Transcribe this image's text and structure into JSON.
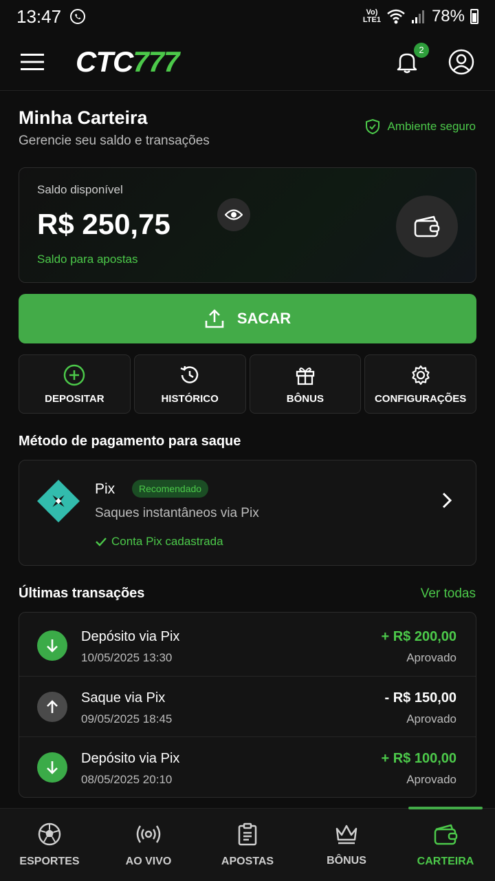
{
  "status_bar": {
    "time": "13:47",
    "network_line1": "Vo)",
    "network_line2": "LTE1",
    "battery": "78%"
  },
  "header": {
    "logo_white": "CTC",
    "logo_green": "777",
    "notification_count": "2"
  },
  "page": {
    "title": "Minha Carteira",
    "subtitle": "Gerencie seu saldo e transações",
    "secure_label": "Ambiente seguro"
  },
  "balance": {
    "label": "Saldo disponível",
    "value": "R$ 250,75",
    "note": "Saldo para apostas"
  },
  "withdraw_button": {
    "label": "SACAR"
  },
  "actions": [
    {
      "label": "DEPOSITAR",
      "icon": "plus-circle-icon"
    },
    {
      "label": "HISTÓRICO",
      "icon": "history-icon"
    },
    {
      "label": "BÔNUS",
      "icon": "gift-icon"
    },
    {
      "label": "CONFIGURAÇÕES",
      "icon": "gear-icon"
    }
  ],
  "payment": {
    "section_title": "Método de pagamento para saque",
    "method_name": "Pix",
    "badge": "Recomendado",
    "description": "Saques instantâneos via Pix",
    "status": "Conta Pix cadastrada"
  },
  "transactions": {
    "section_title": "Últimas transações",
    "view_all": "Ver todas",
    "items": [
      {
        "title": "Depósito via Pix",
        "date": "10/05/2025 13:30",
        "amount": "+ R$ 200,00",
        "status": "Aprovado",
        "direction": "in"
      },
      {
        "title": "Saque via Pix",
        "date": "09/05/2025 18:45",
        "amount": "- R$ 150,00",
        "status": "Aprovado",
        "direction": "out"
      },
      {
        "title": "Depósito via Pix",
        "date": "08/05/2025 20:10",
        "amount": "+ R$ 100,00",
        "status": "Aprovado",
        "direction": "in"
      }
    ]
  },
  "bottom_nav": [
    {
      "label": "ESPORTES",
      "icon": "soccer-ball-icon"
    },
    {
      "label": "AO VIVO",
      "icon": "live-broadcast-icon"
    },
    {
      "label": "APOSTAS",
      "icon": "clipboard-icon"
    },
    {
      "label": "BÔNUS",
      "icon": "crown-icon"
    },
    {
      "label": "CARTEIRA",
      "icon": "wallet-icon",
      "active": true
    }
  ],
  "colors": {
    "accent": "#43ab48",
    "accent_text": "#4cc94a",
    "background": "#0e0e0e"
  }
}
